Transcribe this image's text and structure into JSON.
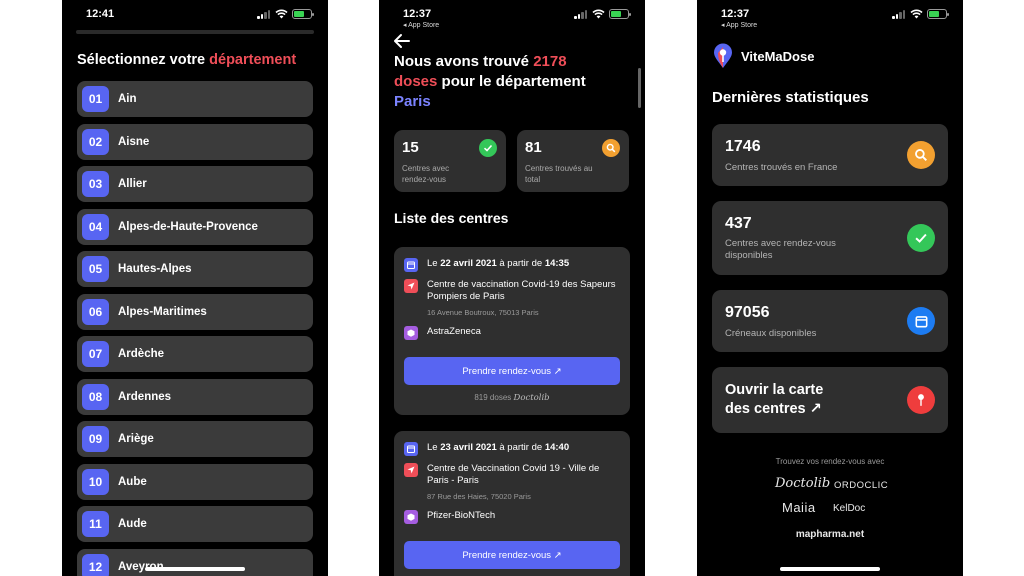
{
  "screen1": {
    "status": {
      "time": "12:41"
    },
    "title_prefix": "Sélectionnez votre ",
    "title_highlight": "département",
    "departments": [
      {
        "num": "01",
        "name": "Ain"
      },
      {
        "num": "02",
        "name": "Aisne"
      },
      {
        "num": "03",
        "name": "Allier"
      },
      {
        "num": "04",
        "name": "Alpes-de-Haute-Provence"
      },
      {
        "num": "05",
        "name": "Hautes-Alpes"
      },
      {
        "num": "06",
        "name": "Alpes-Maritimes"
      },
      {
        "num": "07",
        "name": "Ardèche"
      },
      {
        "num": "08",
        "name": "Ardennes"
      },
      {
        "num": "09",
        "name": "Ariège"
      },
      {
        "num": "10",
        "name": "Aube"
      },
      {
        "num": "11",
        "name": "Aude"
      },
      {
        "num": "12",
        "name": "Aveyron"
      }
    ]
  },
  "screen2": {
    "status": {
      "time": "12:37",
      "back_app": "◂ App Store"
    },
    "title": {
      "pre": "Nous avons trouvé ",
      "count": "2178",
      "mid_red": "doses",
      "post": " pour le département",
      "dept": "Paris"
    },
    "stats": [
      {
        "value": "15",
        "label": "Centres avec rendez-vous",
        "icon": "check-icon",
        "color": "#34c759"
      },
      {
        "value": "81",
        "label": "Centres trouvés au total",
        "icon": "search-icon",
        "color": "#f2a030"
      }
    ],
    "list_title": "Liste des centres",
    "centers": [
      {
        "date_pre": "Le ",
        "date": "22 avril 2021",
        "date_mid": " à partir de ",
        "time": "14:35",
        "name": "Centre de vaccination Covid-19 des Sapeurs Pompiers de Paris",
        "address": "16 Avenue Boutroux, 75013 Paris",
        "vaccine": "AstraZeneca",
        "button": "Prendre rendez-vous ↗",
        "doses": "819 doses",
        "platform": "Doctolib"
      },
      {
        "date_pre": "Le ",
        "date": "23 avril 2021",
        "date_mid": " à partir de ",
        "time": "14:40",
        "name": "Centre de Vaccination Covid 19 - Ville de Paris - Paris",
        "address": "87 Rue des Haies, 75020 Paris",
        "vaccine": "Pfizer-BioNTech",
        "button": "Prendre rendez-vous ↗"
      }
    ]
  },
  "screen3": {
    "status": {
      "time": "12:37",
      "back_app": "◂ App Store"
    },
    "logo": "ViteMaDose",
    "title": "Dernières statistiques",
    "stats": [
      {
        "value": "1746",
        "label": "Centres trouvés en France",
        "icon": "search-icon",
        "color": "#f2a030"
      },
      {
        "value": "437",
        "label": "Centres avec rendez-vous disponibles",
        "icon": "check-icon",
        "color": "#34c759"
      },
      {
        "value": "97056",
        "label": "Créneaux disponibles",
        "icon": "calendar-icon",
        "color": "#1d7cf2"
      }
    ],
    "map_card": {
      "line1": "Ouvrir la carte",
      "line2": "des centres ↗",
      "icon": "map-pin-icon",
      "color": "#ef3d3d"
    },
    "partners_title": "Trouvez vos rendez-vous avec",
    "partners": {
      "doctolib": "Doctolib",
      "ordoclic": "ORDOCLIC",
      "maiia": "Maiia",
      "keldoc": "KelDoc",
      "mapharma": "mapharma.net"
    }
  }
}
